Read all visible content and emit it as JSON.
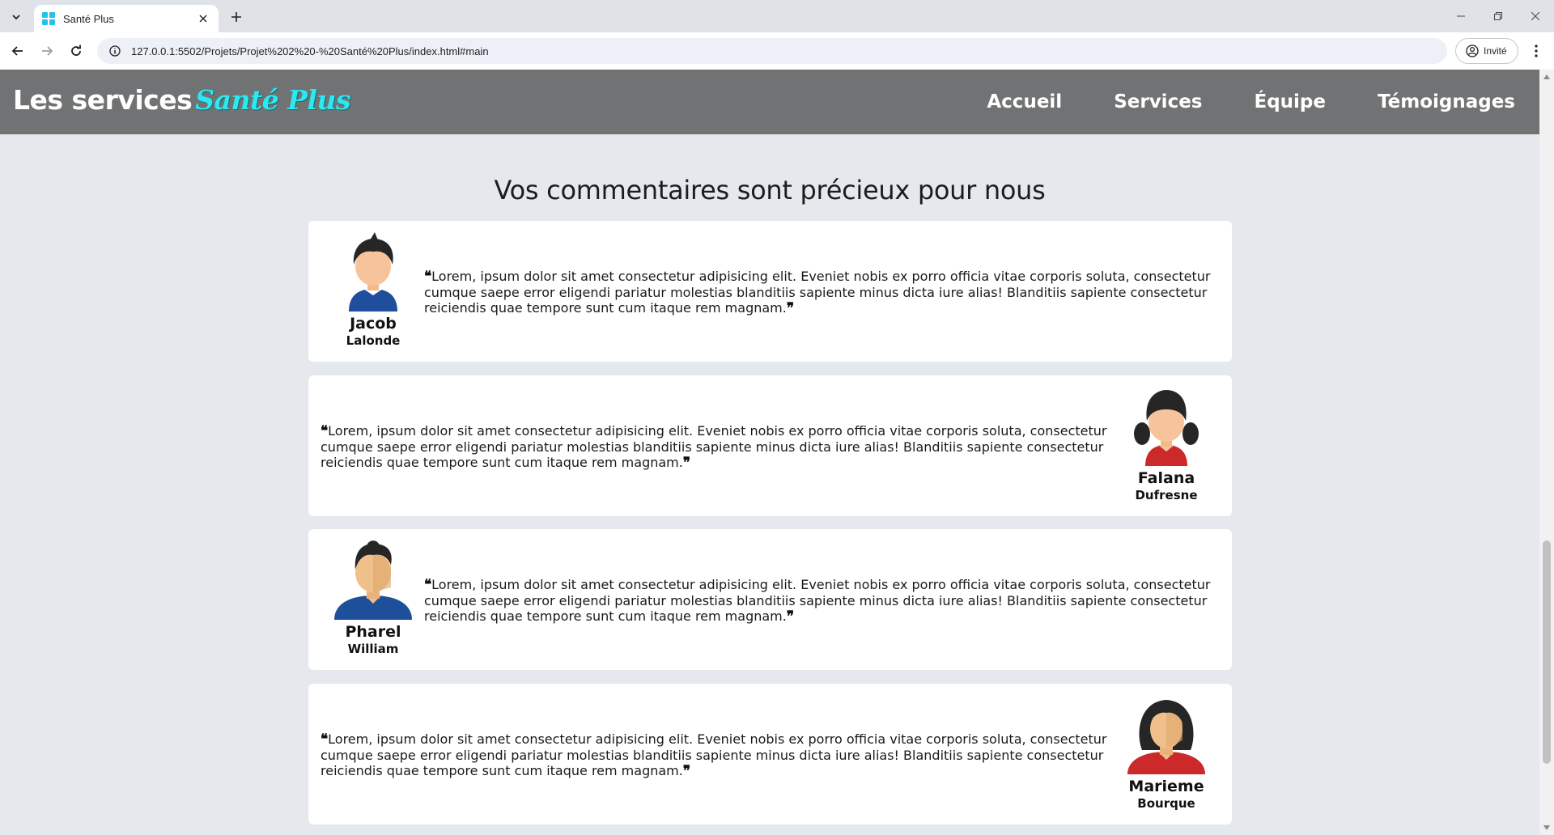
{
  "browser": {
    "tab_title": "Santé Plus",
    "url": "127.0.0.1:5502/Projets/Projet%202%20-%20Santé%20Plus/index.html#main",
    "profile_label": "Invité"
  },
  "header": {
    "brand_prefix": "Les services",
    "brand_accent": "Santé Plus",
    "nav": [
      "Accueil",
      "Services",
      "Équipe",
      "Témoignages"
    ]
  },
  "section": {
    "title": "Vos commentaires sont précieux pour nous"
  },
  "testimonials": [
    {
      "first_name": "Jacob",
      "last_name": "Lalonde",
      "avatar": "boy-avatar-icon",
      "text": "Lorem, ipsum dolor sit amet consectetur adipisicing elit. Eveniet nobis ex porro officia vitae corporis soluta, consectetur cumque saepe error eligendi pariatur molestias blanditiis sapiente minus dicta iure alias! Blanditiis sapiente consectetur reiciendis quae tempore sunt cum itaque rem magnam."
    },
    {
      "first_name": "Falana",
      "last_name": "Dufresne",
      "avatar": "girl-avatar-icon",
      "text": "Lorem, ipsum dolor sit amet consectetur adipisicing elit. Eveniet nobis ex porro officia vitae corporis soluta, consectetur cumque saepe error eligendi pariatur molestias blanditiis sapiente minus dicta iure alias! Blanditiis sapiente consectetur reiciendis quae tempore sunt cum itaque rem magnam."
    },
    {
      "first_name": "Pharel",
      "last_name": "William",
      "avatar": "man-avatar-icon",
      "text": "Lorem, ipsum dolor sit amet consectetur adipisicing elit. Eveniet nobis ex porro officia vitae corporis soluta, consectetur cumque saepe error eligendi pariatur molestias blanditiis sapiente minus dicta iure alias! Blanditiis sapiente consectetur reiciendis quae tempore sunt cum itaque rem magnam."
    },
    {
      "first_name": "Marieme",
      "last_name": "Bourque",
      "avatar": "woman-avatar-icon",
      "text": "Lorem, ipsum dolor sit amet consectetur adipisicing elit. Eveniet nobis ex porro officia vitae corporis soluta, consectetur cumque saepe error eligendi pariatur molestias blanditiis sapiente minus dicta iure alias! Blanditiis sapiente consectetur reiciendis quae tempore sunt cum itaque rem magnam."
    }
  ],
  "colors": {
    "header_bg": "#717273",
    "brand_accent": "#2ee8f0",
    "page_bg": "#e5e8ed",
    "card_bg": "#ffffff"
  }
}
